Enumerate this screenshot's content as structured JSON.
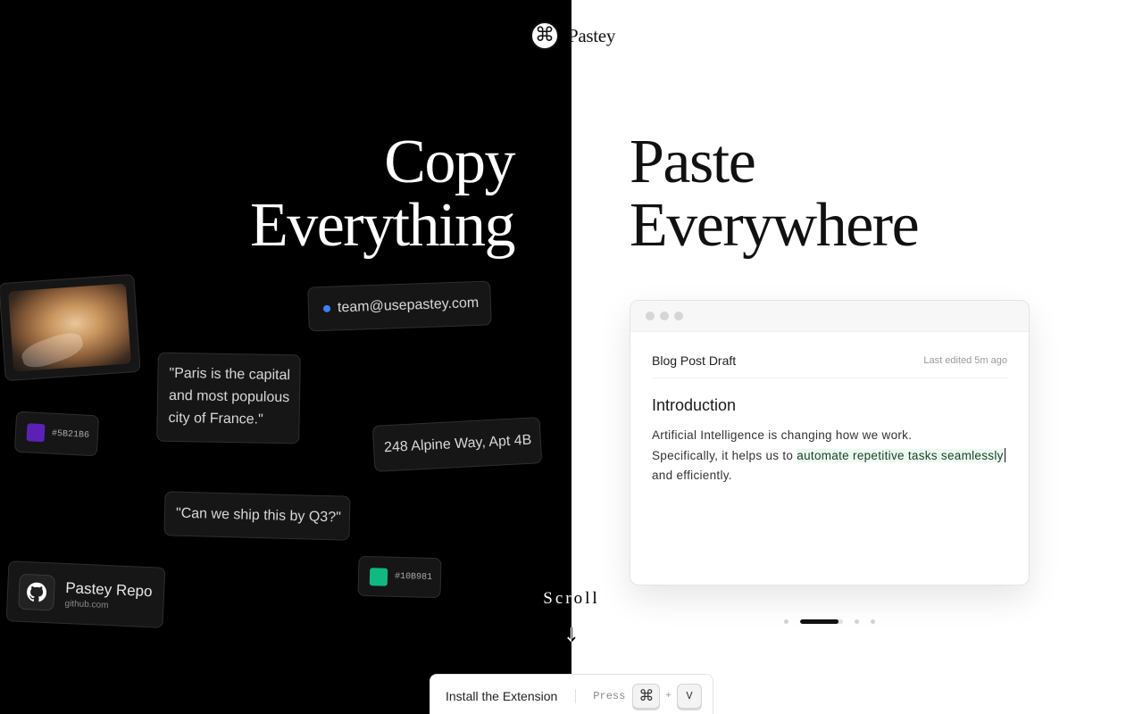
{
  "brand": {
    "name": "Pastey",
    "logo_icon": "command-icon"
  },
  "hero": {
    "copy_lines": [
      "Copy",
      "Everything"
    ],
    "paste_lines": [
      "Paste",
      "Everywhere"
    ]
  },
  "clips": {
    "photo": {
      "icon": "image-thumbnail"
    },
    "email": {
      "text": "team@usepastey.com",
      "dot_color": "#3B82F6"
    },
    "quote": {
      "text": "\"Paris is the capital and most populous city of France.\""
    },
    "color_purple": {
      "hex": "#5B21B6",
      "swatch": "#5B21B6"
    },
    "address": {
      "text": "248 Alpine Way, Apt 4B"
    },
    "question": {
      "text": "\"Can we ship this by Q3?\""
    },
    "color_green": {
      "hex": "#10B981",
      "swatch": "#10B981"
    },
    "repo": {
      "title": "Pastey Repo",
      "subtitle": "github.com",
      "icon": "github-icon"
    }
  },
  "scroll": {
    "label": "Scroll",
    "icon": "arrow-down-icon"
  },
  "editor": {
    "doc_title": "Blog Post Draft",
    "last_edited": "Last edited 5m ago",
    "heading": "Introduction",
    "line1": "Artificial Intelligence is changing how we work.",
    "line2_prefix": "Specifically, it helps us to ",
    "line2_highlight": "automate repetitive tasks seamlessly",
    "line3": "and efficiently.",
    "highlight_color": "#ECFBF2"
  },
  "carousel": {
    "total": 4,
    "active_index": 1,
    "active_progress": 0.9
  },
  "install": {
    "label": "Install the Extension",
    "press_label": "Press",
    "key1": "⌘",
    "plus": "+",
    "key2": "V"
  }
}
